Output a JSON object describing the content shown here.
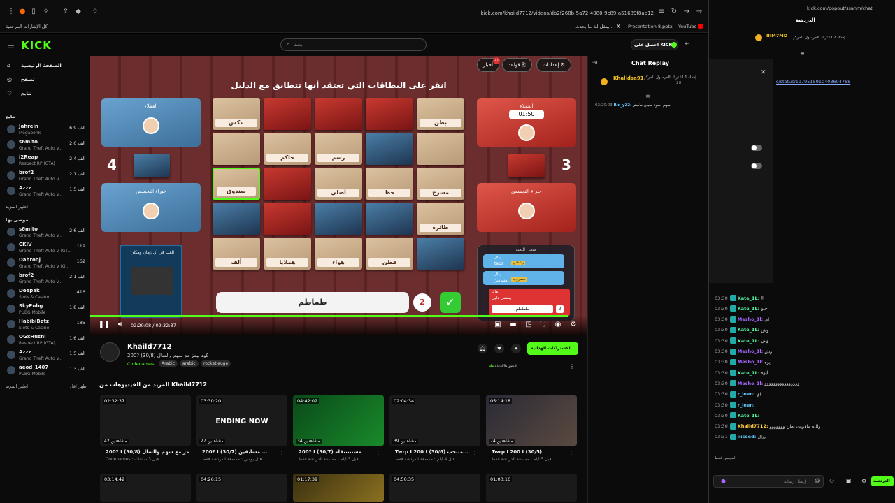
{
  "browser": {
    "url": "kick.com/khaild7712/videos/db2f268b-5a72-4080-9c89-a51689f8ab12",
    "bookmarks": [
      "كل الإشارات المرجعية",
      "YouTube",
      "Presentation 8.pptx",
      "بيتقل لك ما بحدث...",
      "X"
    ]
  },
  "header": {
    "logo": "KICK",
    "search_placeholder": "بحث",
    "get_kicks": "احصل على KICKs"
  },
  "sidebar": {
    "nav": [
      "الصفحة الرئيسية",
      "تصفح",
      "تتابع"
    ],
    "following_title": "تتابع",
    "following": [
      {
        "name": "Jahrein",
        "cat": "Megabonk",
        "count": "6.9 الف"
      },
      {
        "name": "s6mito",
        "cat": "Grand Theft Auto V...",
        "count": "2.6 الف"
      },
      {
        "name": "i2Reap",
        "cat": "Respect RP (GTA)",
        "count": "2.4 الف"
      },
      {
        "name": "brof2",
        "cat": "Grand Theft Auto V...",
        "count": "2.1 الف"
      },
      {
        "name": "Azzz",
        "cat": "Grand Theft Auto V...",
        "count": "1.5 الف"
      }
    ],
    "show_more_1": "اظهر المزيد",
    "recommended_title": "موصى بها",
    "recommended": [
      {
        "name": "s6mito",
        "cat": "Grand Theft Auto V...",
        "count": "2.6 الف"
      },
      {
        "name": "CKIV",
        "cat": "Grand Theft Auto V (GT...",
        "count": "119"
      },
      {
        "name": "Dahrooj",
        "cat": "Grand Theft Auto V (G...",
        "count": "162"
      },
      {
        "name": "brof2",
        "cat": "Grand Theft Auto V...",
        "count": "2.1 الف"
      },
      {
        "name": "Deepak",
        "cat": "Slots & Casino",
        "count": "416"
      },
      {
        "name": "SkyPubg",
        "cat": "PUBG Mobile",
        "count": "1.8 الف"
      },
      {
        "name": "HabibiBetz",
        "cat": "Slots & Casino",
        "count": "185"
      },
      {
        "name": "OGxHusni",
        "cat": "Respect RP (GTA)",
        "count": "1.6 الف"
      },
      {
        "name": "Azzz",
        "cat": "Grand Theft Auto V...",
        "count": "1.5 الف"
      },
      {
        "name": "aeod_1407",
        "cat": "PUBG Mobile",
        "count": "1.3 الف"
      }
    ],
    "show_more_2": "اظهر المزيد",
    "show_less": "اظهر اقل"
  },
  "video": {
    "game_title": "انقر على البطاقات التي تعتقد أنها تتطابق مع الدليل",
    "settings": "إعدادات",
    "rules": "قواعد",
    "news": "أخبار",
    "news_badge": "21",
    "blue_team": {
      "score": "4",
      "spymaster": "العملاء",
      "operative_label": "خبراء التجسس"
    },
    "red_team": {
      "score": "3",
      "agents": "العملاء",
      "timer": "01:50",
      "spies": "خبراء التجسس"
    },
    "cards": [
      "عكس",
      "",
      "",
      "",
      "بطن",
      "",
      "حاكم",
      "رسم",
      "",
      "",
      "صندوق",
      "",
      "أصلي",
      "حظ",
      "مسرح",
      "",
      "",
      "",
      "",
      "طائرة",
      "ألف",
      "هملايا",
      "هواء",
      "قطن",
      ""
    ],
    "clue": "طماطم",
    "clue_number": "2",
    "history_title": "سجل اللعبة",
    "history": [
      {
        "user": "يتال",
        "word": "taps",
        "tag": "رشقني"
      },
      {
        "user": "يتال",
        "word": "مساميرُ",
        "tag": "مصروب"
      },
      {
        "user": "هاك",
        "word": "يمشي دليل",
        "tag": ""
      },
      {
        "user": "",
        "word": "طماطم",
        "tag": "2"
      }
    ],
    "time_current": "02:20:08",
    "time_total": "02:32:37",
    "progress_fraction": 0.96,
    "promo_card": "العب في أي زمان ومكان"
  },
  "channel": {
    "name": "Khaild7712",
    "stream_title": "كود نيمز مع سهم والسال (30/8) ?200",
    "tags": [
      "Codenames",
      "Arabic",
      "arabic",
      "rocketleuge"
    ],
    "subscribe": "الاشتراكات الهدائية",
    "views": "44",
    "views_label": "المشاهدات",
    "ago": "قبل 3 ساعات"
  },
  "more_videos_title": "المزيد من الفيديوهات من Khaild7712",
  "more_videos": [
    {
      "dur": "02:32:37",
      "views": "42 مشاهدين",
      "title": "200? I (30/8) كود نيمز مع سهم والسال",
      "sub": "Codenames · قبل 3 ساعات"
    },
    {
      "dur": "03:30:20",
      "views": "27 مشاهدين",
      "title": "200? I (30/7) مسابقين ...",
      "sub": "قبل يومين · مسمعة الدردشة فقط",
      "thumb_text": "ENDING NOW"
    },
    {
      "dur": "04:42:02",
      "views": "34 مشاهدين",
      "title": "200? I (30/7) مستتتتتقلة",
      "sub": "قبل 3 أيام · مسمعة الدردشة فقط"
    },
    {
      "dur": "02:04:34",
      "views": "39 مشاهدين",
      "title": "Twrp I 200 I (30/6) منتخب...",
      "sub": "قبل 4 أيام · مسمعة الدردشة فقط"
    },
    {
      "dur": "05:14:18",
      "views": "74 مشاهدين",
      "title": "Twrp I 200 I (30/5)",
      "sub": "قبل 5 أيام · مسمعة الدردشة فقط"
    }
  ],
  "more_videos_row2": [
    "03:14:42",
    "04:26:15",
    "01:17:39",
    "04:50:35",
    "01:00:16"
  ],
  "chat_replay": {
    "title": "Chat Replay",
    "pinned_user": "Khalidsa91",
    "pinned_text": "إهداء 1 اشتراك المرسول المركز",
    "pinned_badge": "2th",
    "messages": [
      {
        "ts": "02:20:03",
        "user": "Rix_y22:",
        "text": "سهم اسوء سباي ماستر"
      }
    ]
  },
  "popout": {
    "url": "kick.com/popout/ssahm/chat",
    "title": "الدردشة",
    "pinned_user": "IIIM7MD",
    "pinned_text": "إهداء 2 اشتراك المرسول المركز",
    "link": "s/status/1979515910403604768",
    "messages": [
      {
        "ts": "03:30",
        "user": "Kate_1L:",
        "text": "ااا"
      },
      {
        "ts": "03:30",
        "user": "Kate_1L:",
        "text": "حلو"
      },
      {
        "ts": "03:30",
        "user": "Mesho_1l:",
        "text": "اي"
      },
      {
        "ts": "03:30",
        "user": "Kate_1L:",
        "text": "وش"
      },
      {
        "ts": "03:30",
        "user": "Kate_1L:",
        "text": "وش"
      },
      {
        "ts": "03:30",
        "user": "Mesho_1l:",
        "text": "وش"
      },
      {
        "ts": "03:30",
        "user": "Mesho_1l:",
        "text": "ايوه"
      },
      {
        "ts": "03:30",
        "user": "Kate_1L:",
        "text": "ايوه"
      },
      {
        "ts": "03:30",
        "user": "Mesho_1l:",
        "text": "وووووووووووووووو"
      },
      {
        "ts": "03:30",
        "user": "r_leen:",
        "text": "اي"
      },
      {
        "ts": "03:30",
        "user": "r_leen:",
        "text": ""
      },
      {
        "ts": "03:30",
        "user": "Kate_1L:",
        "text": ""
      },
      {
        "ts": "03:30",
        "user": "Khaild7712:",
        "text": "والله ماقويت بطن ووووووو"
      },
      {
        "ts": "03:31",
        "user": "iiiceed:",
        "text": "بدال"
      }
    ],
    "input_placeholder": "إرسال رسالة",
    "send": "الدردشة",
    "emote_label": "المايسن فقط"
  }
}
